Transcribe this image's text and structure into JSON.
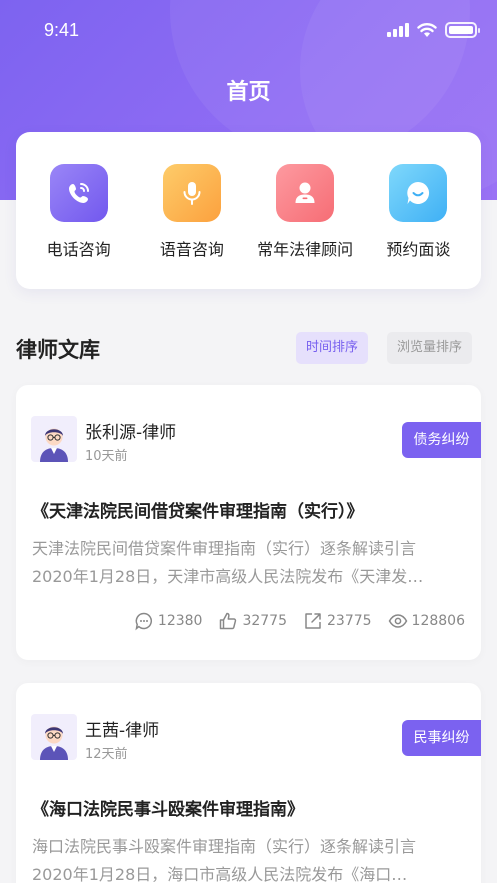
{
  "status_bar": {
    "time": "9:41"
  },
  "header": {
    "title": "首页"
  },
  "quick_actions": [
    {
      "label": "电话咨询",
      "icon": "phone-icon",
      "color": "#7b62f0"
    },
    {
      "label": "语音咨询",
      "icon": "microphone-icon",
      "color": "#fdb24a"
    },
    {
      "label": "常年法律顾问",
      "icon": "person-icon",
      "color": "#fb8086"
    },
    {
      "label": "预约面谈",
      "icon": "chat-icon",
      "color": "#57c2f8"
    }
  ],
  "library": {
    "title": "律师文库",
    "sort_time": "时间排序",
    "sort_views": "浏览量排序"
  },
  "articles": [
    {
      "author": "张利源-律师",
      "ago": "10天前",
      "tag": "债务纠纷",
      "title": "《天津法院民间借贷案件审理指南（实行）》",
      "body_line1": "天津法院民间借贷案件审理指南（实行）逐条解读引言",
      "body_line2": "2020年1月28日，天津市高级人民法院发布《天津发…",
      "comments": "12380",
      "likes": "32775",
      "shares": "23775",
      "views": "128806"
    },
    {
      "author": "王茜-律师",
      "ago": "12天前",
      "tag": "民事纠纷",
      "title": "《海口法院民事斗殴案件审理指南》",
      "body_line1": "海口法院民事斗殴案件审理指南（实行）逐条解读引言",
      "body_line2": "2020年1月28日，海口市高级人民法院发布《海口…"
    }
  ]
}
